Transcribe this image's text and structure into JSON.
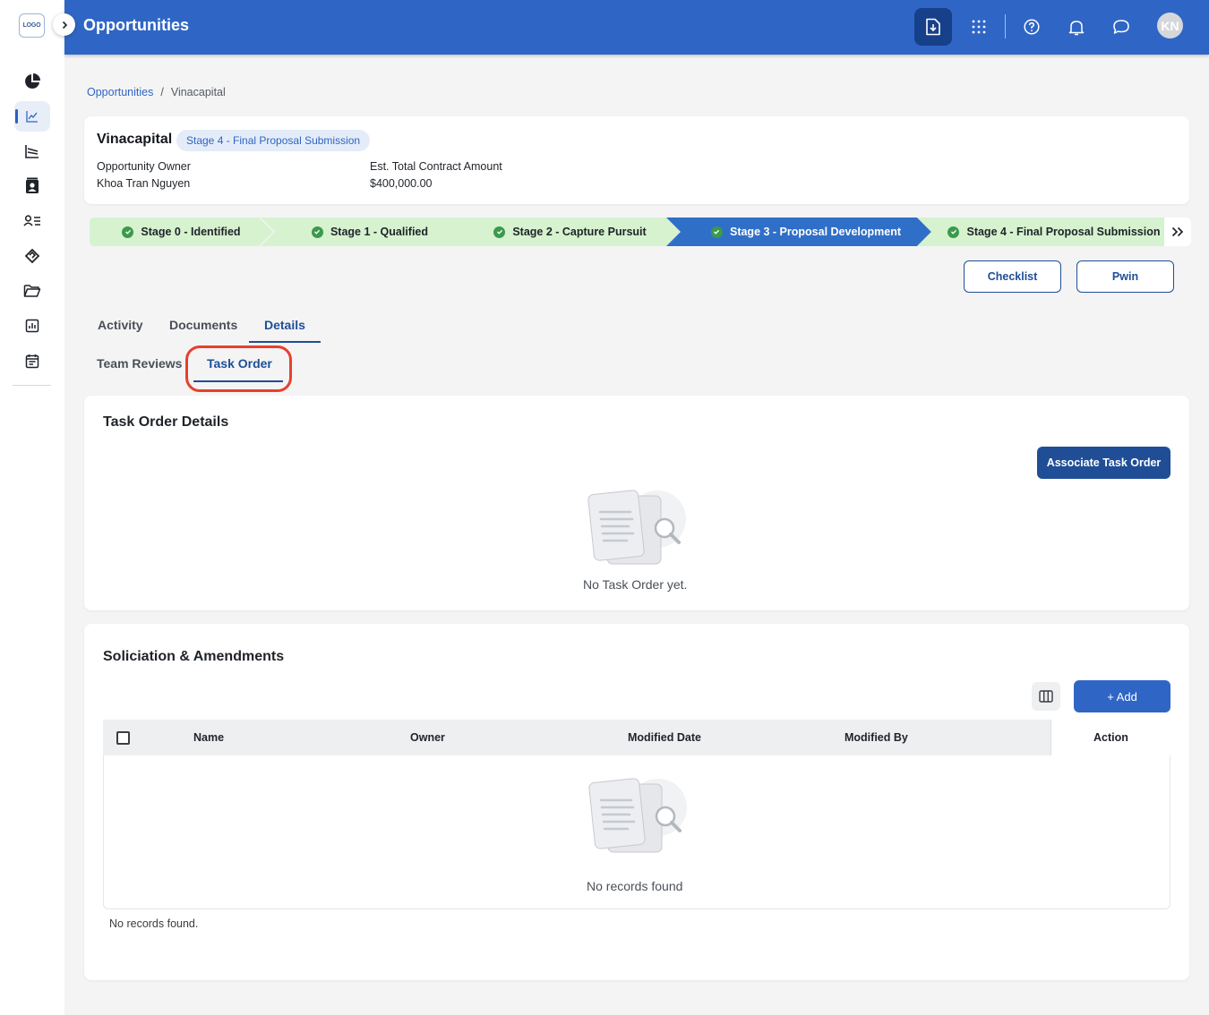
{
  "app": {
    "logo_text": "LOGO",
    "title": "Opportunities",
    "avatar_initials": "KN",
    "brand_color": "#2f66c6"
  },
  "sidebar": {
    "items": [
      {
        "icon": "pie-chart-icon"
      },
      {
        "icon": "trend-chart-icon",
        "active": true
      },
      {
        "icon": "pipeline-chart-icon"
      },
      {
        "icon": "contact-card-icon"
      },
      {
        "icon": "user-list-icon"
      },
      {
        "icon": "handshake-icon"
      },
      {
        "icon": "folder-icon"
      },
      {
        "icon": "report-icon"
      },
      {
        "icon": "calendar-icon"
      }
    ]
  },
  "header_actions": [
    "download-icon",
    "apps-grid-icon",
    "help-icon",
    "bell-icon",
    "chat-icon"
  ],
  "breadcrumb": {
    "parent": "Opportunities",
    "separator": "/",
    "current": "Vinacapital"
  },
  "opportunity": {
    "name": "Vinacapital",
    "stage_badge": "Stage 4 - Final Proposal Submission",
    "owner_label": "Opportunity Owner",
    "owner_value": "Khoa Tran Nguyen",
    "amount_label": "Est. Total Contract Amount",
    "amount_value": "$400,000.00"
  },
  "stages": [
    {
      "label": "Stage 0 - Identified",
      "state": "done"
    },
    {
      "label": "Stage 1 - Qualified",
      "state": "done"
    },
    {
      "label": "Stage 2 - Capture Pursuit",
      "state": "done"
    },
    {
      "label": "Stage 3 - Proposal Development",
      "state": "current"
    },
    {
      "label": "Stage 4 - Final Proposal Submission",
      "state": "done"
    }
  ],
  "actions": {
    "checklist": "Checklist",
    "pwin": "Pwin"
  },
  "tabs": {
    "activity": "Activity",
    "documents": "Documents",
    "details": "Details",
    "active": "Details"
  },
  "subtabs": {
    "team_reviews": "Team Reviews",
    "task_order": "Task Order",
    "active": "Task Order"
  },
  "task_order": {
    "title": "Task Order Details",
    "associate_button": "Associate Task Order",
    "empty_text": "No Task Order yet."
  },
  "solicitation": {
    "title": "Soliciation & Amendments",
    "add_button": "+ Add",
    "columns": [
      "Name",
      "Owner",
      "Modified Date",
      "Modified By",
      "Action"
    ],
    "rows": [],
    "empty_text": "No records found",
    "footer_text": "No records found."
  }
}
